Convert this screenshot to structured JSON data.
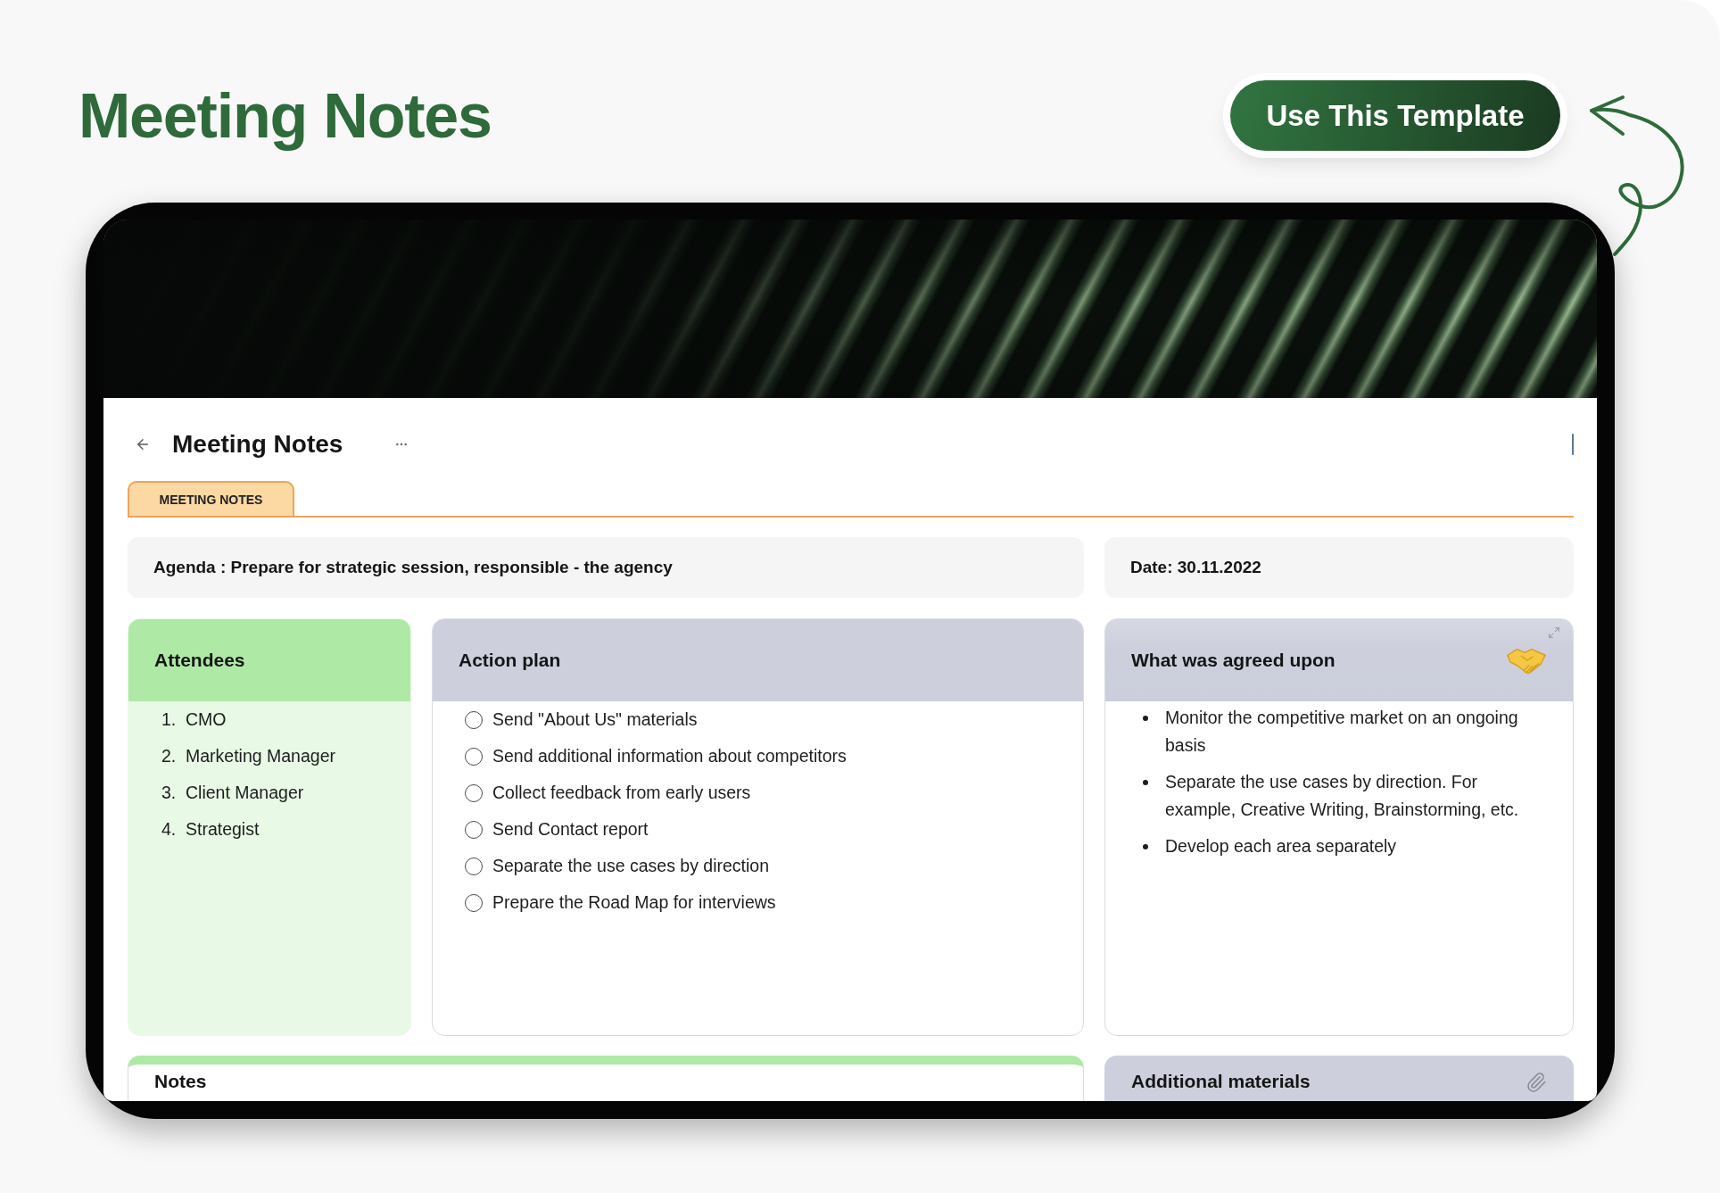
{
  "page": {
    "title": "Meeting Notes",
    "cta_button": "Use This Template"
  },
  "document": {
    "title": "Meeting Notes",
    "tabs": [
      {
        "label": "MEETING NOTES",
        "selected": true
      }
    ],
    "agenda": "Agenda : Prepare for strategic session, responsible - the agency",
    "date": "Date: 30.11.2022",
    "cards": [
      {
        "kind": "numbered",
        "title": "Attendees",
        "items": [
          {
            "number": "1.",
            "text": "CMO"
          },
          {
            "number": "2.",
            "text": "Marketing Manager"
          },
          {
            "number": "3.",
            "text": "Client Manager"
          },
          {
            "number": "4.",
            "text": "Strategist"
          }
        ]
      },
      {
        "kind": "checklist",
        "title": "Action plan",
        "items": [
          {
            "text": "Send \"About Us\" materials",
            "checked": false
          },
          {
            "text": "Send additional information about competitors",
            "checked": false
          },
          {
            "text": "Collect feedback from early users",
            "checked": false
          },
          {
            "text": "Send Contact report",
            "checked": false
          },
          {
            "text": "Separate the use cases by direction",
            "checked": false
          },
          {
            "text": "Prepare the Road Map for interviews",
            "checked": false
          }
        ]
      },
      {
        "kind": "bullets",
        "title": "What was agreed upon",
        "items": [
          {
            "text": "Monitor the competitive market on an ongoing basis"
          },
          {
            "text": "Separate the use cases by direction. For example, Creative Writing, Brainstorming, etc."
          },
          {
            "text": "Develop each area separately"
          }
        ]
      }
    ],
    "bottom_cards": [
      {
        "kind": "notes",
        "title": "Notes"
      },
      {
        "kind": "materials",
        "title": "Additional materials"
      }
    ]
  }
}
